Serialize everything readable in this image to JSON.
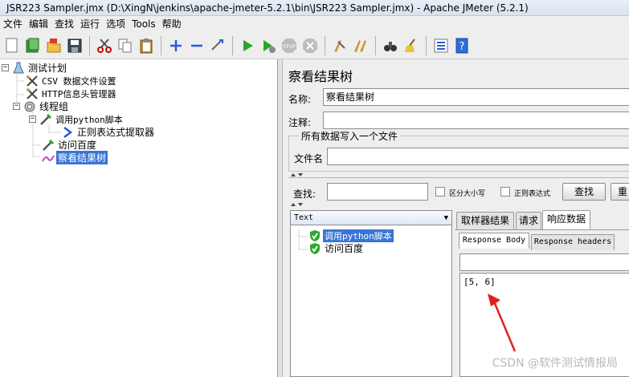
{
  "window": {
    "title": "JSR223 Sampler.jmx (D:\\XingN\\jenkins\\apache-jmeter-5.2.1\\bin\\JSR223 Sampler.jmx) - Apache JMeter (5.2.1)"
  },
  "menu": [
    "文件",
    "编辑",
    "查找",
    "运行",
    "选项",
    "Tools",
    "帮助"
  ],
  "tree": {
    "test_plan": "测试计划",
    "csv": "CSV 数据文件设置",
    "http_header": "HTTP信息头管理器",
    "thread_group": "线程组",
    "python_sampler": "调用python脚本",
    "regex_extractor": "正则表达式提取器",
    "visit_baidu": "访问百度",
    "result_tree": "察看结果树"
  },
  "panel": {
    "title": "察看结果树",
    "name_label": "名称:",
    "name_value": "察看结果树",
    "comment_label": "注释:",
    "comment_value": "",
    "group_label": "所有数据写入一个文件",
    "file_label": "文件名",
    "file_value": "",
    "search_label": "查找:",
    "search_value": "",
    "case_sensitive": "区分大小写",
    "regex": "正则表达式",
    "search_button": "查找",
    "reset_button": "重"
  },
  "renderer": {
    "selected": "Text"
  },
  "results": [
    {
      "label": "调用python脚本",
      "status": "success"
    },
    {
      "label": "访问百度",
      "status": "success"
    }
  ],
  "tabs": [
    "取样器结果",
    "请求",
    "响应数据"
  ],
  "subtabs": [
    "Response Body",
    "Response headers"
  ],
  "response_body": "[5, 6]",
  "watermark": "CSDN @软件测试情报局",
  "colors": {
    "selection": "#3875d7",
    "arrow": "#e02020",
    "success": "#2ea82e"
  }
}
